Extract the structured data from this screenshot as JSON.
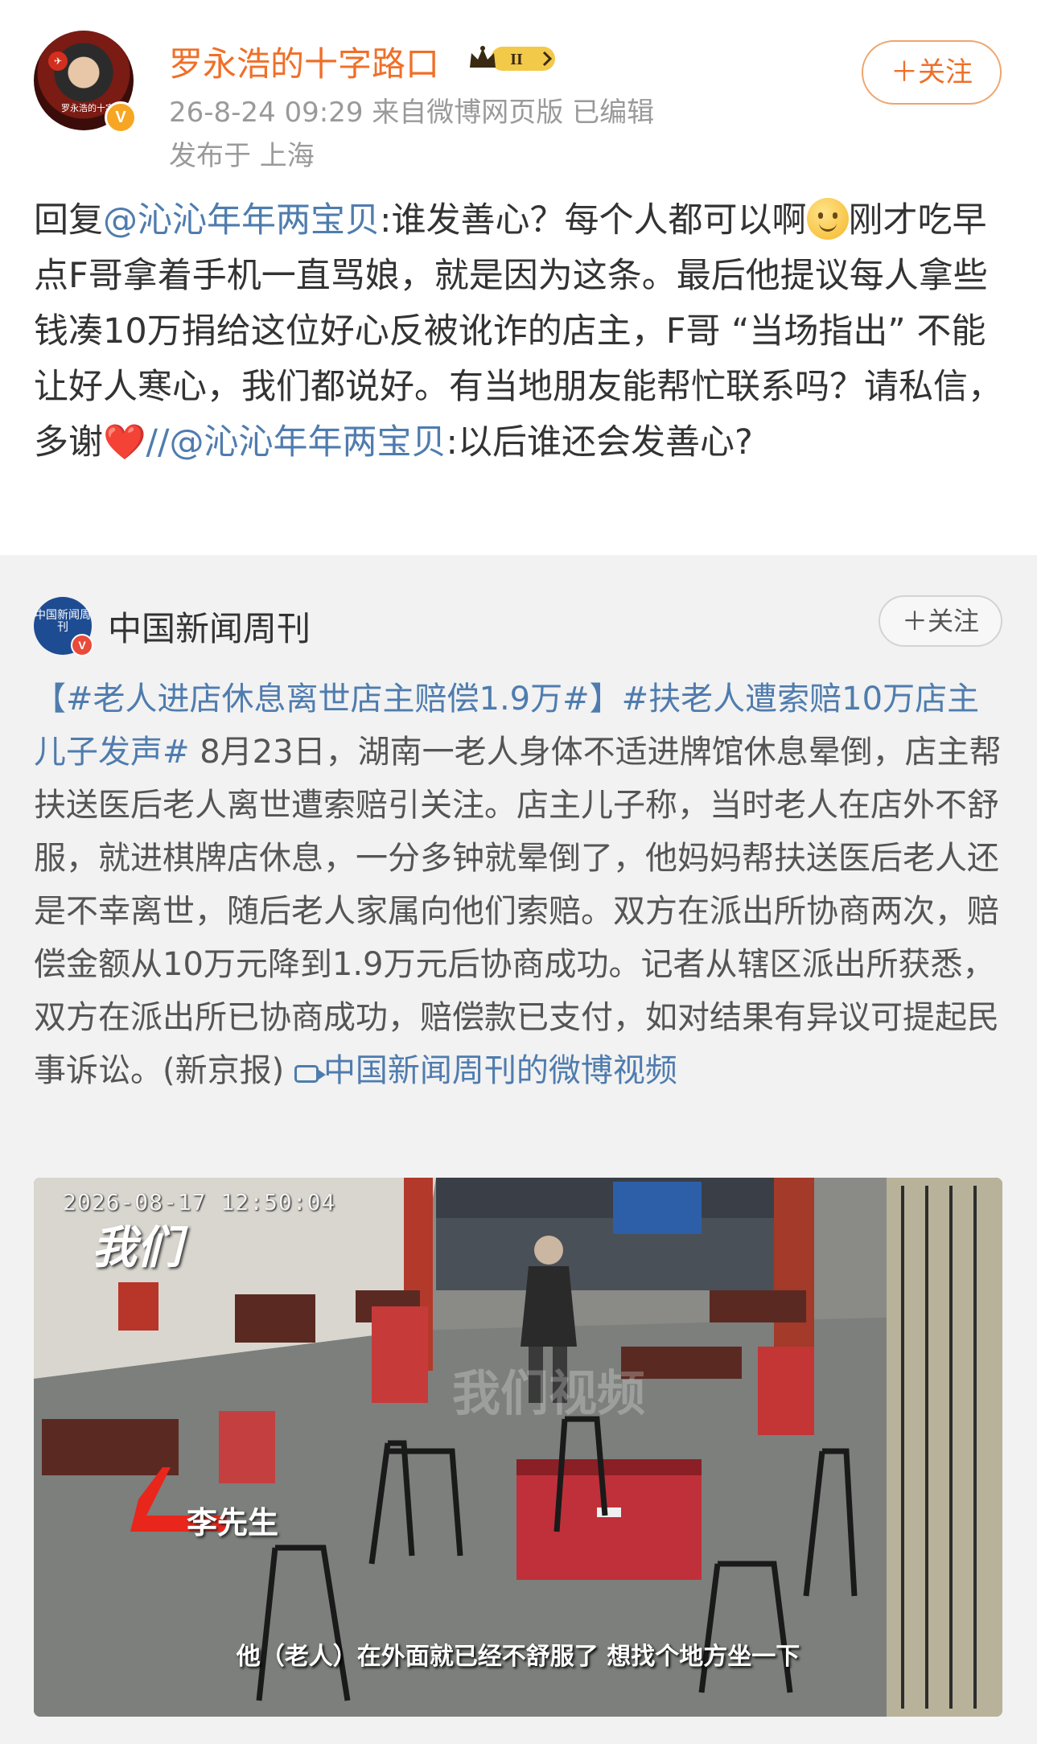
{
  "post": {
    "username": "罗永浩的十字路口",
    "level_badge": "II",
    "meta_line": "26-8-24 09:29  来自微博网页版  已编辑",
    "location_line": "发布于 上海",
    "follow_label": "＋关注",
    "avatar_caption": "罗永浩的十字路口",
    "body": {
      "reply_prefix": "回复",
      "mention1": "@沁沁年年两宝贝",
      "text1": ":谁发善心？每个人都可以啊",
      "text2": "刚才吃早点F哥拿着手机一直骂娘，就是因为这条。最后他提议每人拿些钱凑10万捐给这位好心反被讹诈的店主，F哥 “当场指出” 不能让好人寒心，我们都说好。有当地朋友能帮忙联系吗？请私信，多谢",
      "heart": "❤️",
      "separator": "//",
      "mention2": "@沁沁年年两宝贝",
      "text3": ":以后谁还会发善心?"
    }
  },
  "repost": {
    "account_name": "中国新闻周刊",
    "avatar_text": "中国新闻周刊",
    "follow_label": "＋关注",
    "hashtag1": "【#老人进店休息离世店主赔偿1.9万#】",
    "hashtag2": "#扶老人遭索赔10万店主儿子发声#",
    "text": " 8月23日，湖南一老人身体不适进牌馆休息晕倒，店主帮扶送医后老人离世遭索赔引关注。店主儿子称，当时老人在店外不舒服，就进棋牌店休息，一分多钟就晕倒了，他妈妈帮扶送医后老人还是不幸离世，随后老人家属向他们索赔。双方在派出所协商两次，赔偿金额从10万元降到1.9万元后协商成功。记者从辖区派出所获悉，双方在派出所已协商成功，赔偿款已支付，如对结果有异议可提起民事诉讼。(新京报) ",
    "video_link": "中国新闻周刊的微博视频",
    "video": {
      "timestamp": "2026-08-17  12:50:04",
      "logo_text": "我们",
      "watermark": "我们视频",
      "speaker_label": "李先生",
      "subtitle": "他（老人）在外面就已经不舒服了 想找个地方坐一下"
    }
  },
  "colors": {
    "username_orange": "#f06f28",
    "link_blue": "#4f7cae",
    "meta_gray": "#9a9a9a",
    "repost_bg": "#f2f2f2"
  }
}
